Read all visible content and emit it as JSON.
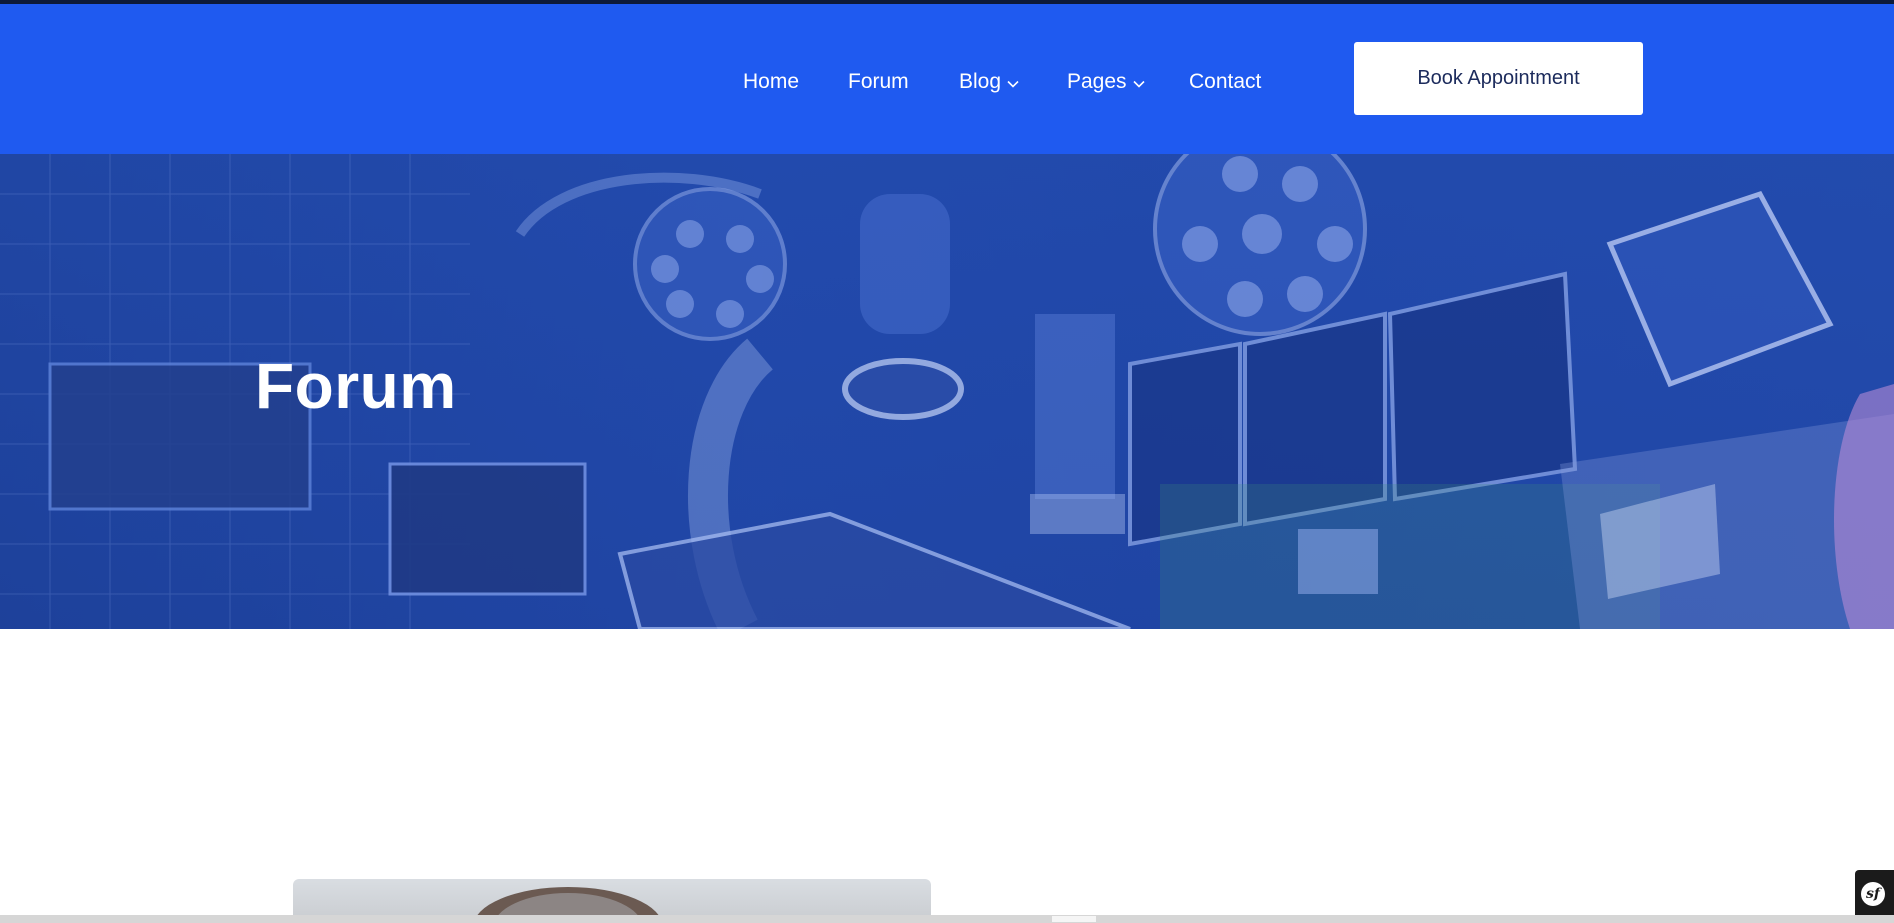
{
  "nav": {
    "items": [
      {
        "label": "Home"
      },
      {
        "label": "Forum"
      },
      {
        "label": "Blog"
      },
      {
        "label": "Pages"
      },
      {
        "label": "Contact"
      }
    ],
    "cta_label": "Book Appointment"
  },
  "hero": {
    "title": "Forum"
  },
  "colors": {
    "brand_blue": "#1f5af0",
    "hero_overlay": "#2148aa",
    "cta_text": "#1c2b5c"
  },
  "icons": {
    "dropdown": "chevron-down-icon",
    "debug_toolbar": "symfony-logo-icon"
  }
}
